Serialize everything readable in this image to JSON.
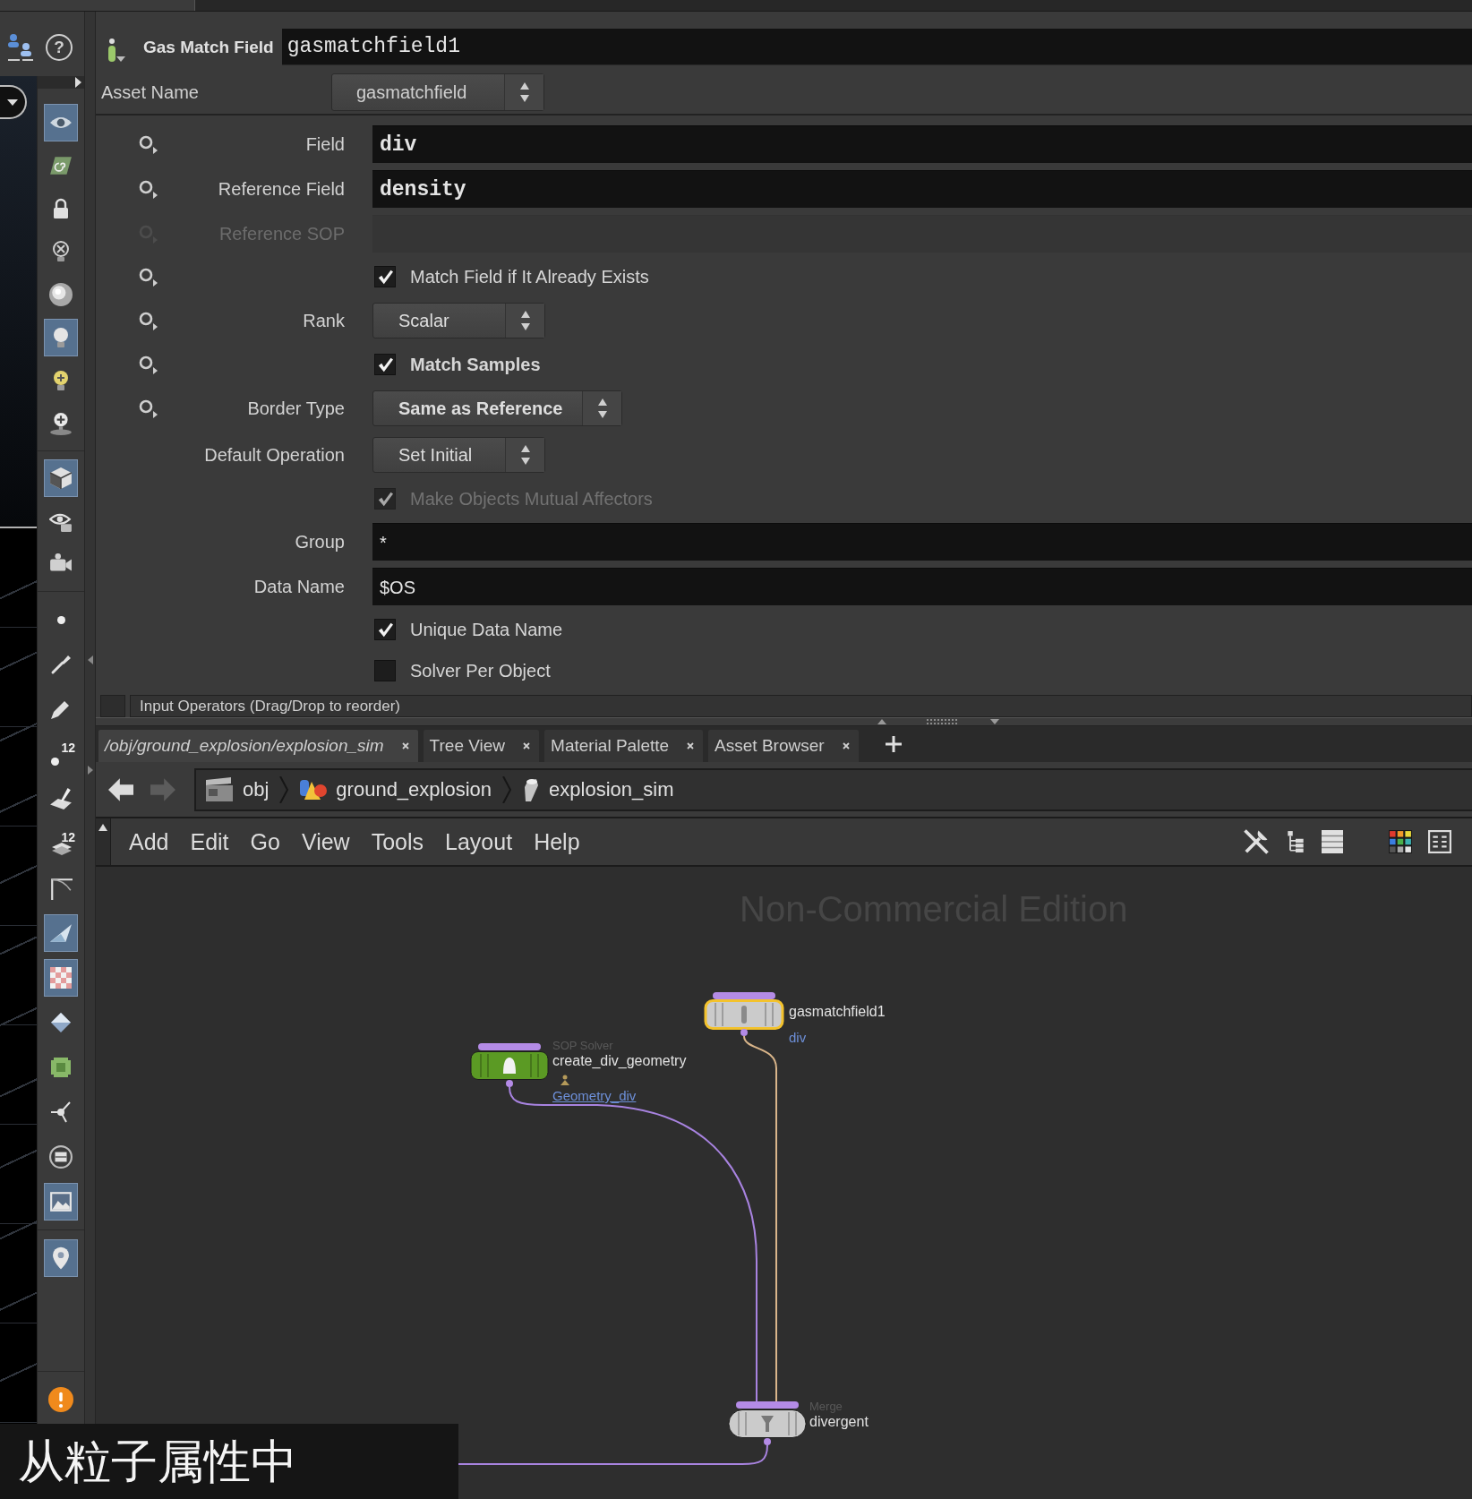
{
  "left_panel": {
    "help_button": "?",
    "tool_groups": [
      [
        {
          "selected": true
        },
        {
          "selected": false
        },
        {
          "selected": false
        },
        {
          "selected": false
        },
        {
          "selected": false
        },
        {
          "selected": true
        },
        {
          "selected": false
        },
        {
          "selected": false
        }
      ],
      [
        {
          "selected": true
        },
        {
          "selected": false
        },
        {
          "selected": false
        }
      ],
      [
        {
          "selected": false
        },
        {
          "selected": false
        },
        {
          "selected": false
        },
        {
          "selected": false,
          "badge": "12"
        },
        {
          "selected": false
        },
        {
          "selected": false,
          "badge": "12"
        },
        {
          "selected": false
        },
        {
          "selected": true
        },
        {
          "selected": true
        },
        {
          "selected": false
        },
        {
          "selected": false
        },
        {
          "selected": false
        },
        {
          "selected": false
        },
        {
          "selected": true
        }
      ],
      [
        {
          "selected": true
        }
      ],
      [
        {
          "selected": false
        }
      ]
    ]
  },
  "parameters": {
    "node_type": "Gas Match Field",
    "node_name": "gasmatchfield1",
    "asset_name": {
      "label": "Asset Name",
      "value": "gasmatchfield"
    },
    "params": [
      {
        "kind": "text",
        "label": "Field",
        "value": "div",
        "modified": true,
        "animatable": true,
        "disabled": false
      },
      {
        "kind": "text",
        "label": "Reference Field",
        "value": "density",
        "modified": true,
        "animatable": true,
        "disabled": false
      },
      {
        "kind": "text",
        "label": "Reference SOP",
        "animatable": true,
        "disabled": true
      },
      {
        "kind": "toggle",
        "label": "Match Field if It Already Exists",
        "checked": true,
        "modified": false,
        "animatable": true,
        "disabled": false
      },
      {
        "kind": "menu",
        "label": "Rank",
        "value": "Scalar",
        "modified": false,
        "animatable": true,
        "disabled": false
      },
      {
        "kind": "toggle",
        "label": "Match Samples",
        "checked": true,
        "modified": true,
        "animatable": true,
        "disabled": false
      },
      {
        "kind": "menu",
        "label": "Border Type",
        "value": "Same as Reference",
        "modified": true,
        "animatable": true,
        "disabled": false
      },
      {
        "kind": "menu",
        "label": "Default Operation",
        "value": "Set Initial",
        "modified": false,
        "animatable": false,
        "disabled": false
      },
      {
        "kind": "toggle",
        "label": "Make Objects Mutual Affectors",
        "checked": true,
        "modified": false,
        "animatable": false,
        "disabled": true
      },
      {
        "kind": "text",
        "label": "Group",
        "value": "*",
        "modified": false,
        "animatable": false,
        "disabled": false
      },
      {
        "kind": "text",
        "label": "Data Name",
        "value": "$OS",
        "modified": false,
        "animatable": false,
        "disabled": false
      },
      {
        "kind": "toggle",
        "label": "Unique Data Name",
        "checked": true,
        "modified": false,
        "animatable": false,
        "disabled": false
      },
      {
        "kind": "toggle",
        "label": "Solver Per Object",
        "checked": false,
        "modified": false,
        "animatable": false,
        "disabled": false
      }
    ],
    "input_operators": "Input Operators (Drag/Drop to reorder)"
  },
  "network_pane": {
    "tabs": [
      {
        "kind": "path",
        "label": "/obj/ground_explosion/explosion_sim",
        "selected": true
      },
      {
        "kind": "pane",
        "label": "Tree View",
        "selected": false
      },
      {
        "kind": "pane",
        "label": "Material Palette",
        "selected": false
      },
      {
        "kind": "pane",
        "label": "Asset Browser",
        "selected": false
      }
    ],
    "history": {
      "back_enabled": true,
      "forward_enabled": false
    },
    "breadcrumbs": [
      {
        "label": "obj"
      },
      {
        "label": "ground_explosion"
      },
      {
        "label": "explosion_sim"
      }
    ],
    "menu": [
      "Add",
      "Edit",
      "Go",
      "View",
      "Tools",
      "Layout",
      "Help"
    ],
    "edition_label": "Non-Commercial Edition",
    "nodes": [
      {
        "kind": "field",
        "name": "gasmatchfield1",
        "output": {
          "label": "div",
          "underlined": false
        },
        "color": "#cbcbcb",
        "selected": true
      },
      {
        "kind": "solver",
        "type": "SOP Solver",
        "name": "create_div_geometry",
        "output": {
          "label": "Geometry_div",
          "underlined": true
        },
        "color": "#5b9a24",
        "selected": false
      },
      {
        "kind": "merge",
        "type": "Merge",
        "name": "divergent",
        "color": "#cbcbcb",
        "selected": false
      }
    ]
  },
  "subtitle": "从粒子属性中"
}
